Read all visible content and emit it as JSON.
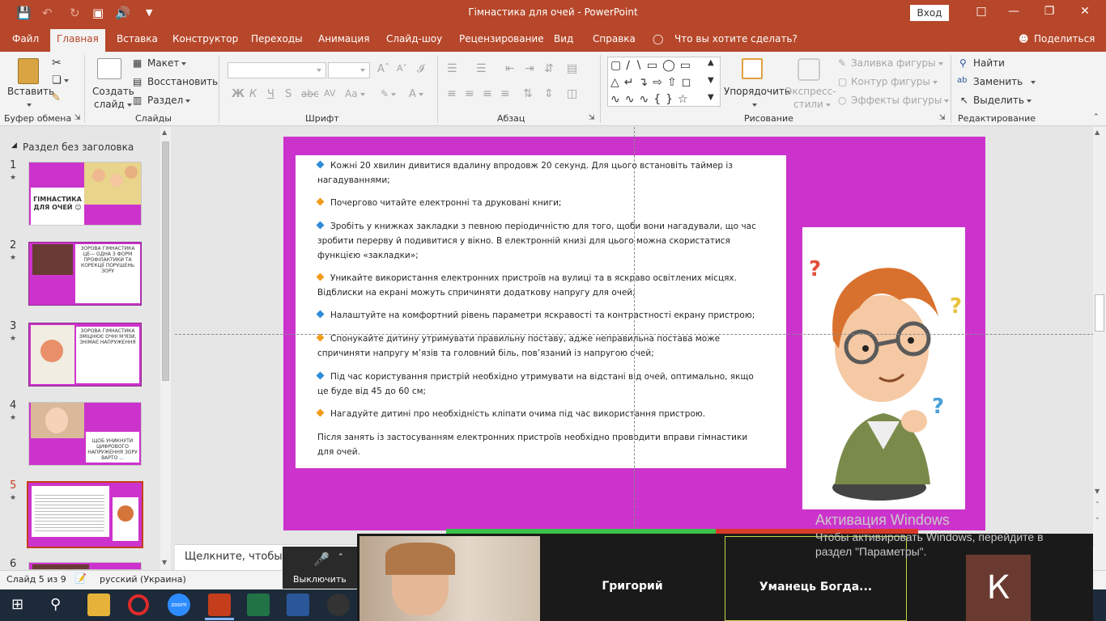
{
  "app": {
    "title": "Гімнастика для очей  -  PowerPoint",
    "signin": "Вход"
  },
  "tabs": [
    "Файл",
    "Главная",
    "Вставка",
    "Конструктор",
    "Переходы",
    "Анимация",
    "Слайд-шоу",
    "Рецензирование",
    "Вид",
    "Справка",
    "Что вы хотите сделать?"
  ],
  "share": "Поделиться",
  "ribbon": {
    "paste": "Вставить",
    "clipboard_group": "Буфер обмена",
    "new_slide_1": "Создать",
    "new_slide_2": "слайд",
    "layout": "Макет",
    "reset": "Восстановить",
    "section": "Раздел",
    "slides_group": "Слайды",
    "font_group": "Шрифт",
    "paragraph_group": "Абзац",
    "arrange": "Упорядочить",
    "quick_styles_1": "Экспресс-",
    "quick_styles_2": "стили",
    "shape_fill": "Заливка фигуры",
    "shape_outline": "Контур фигуры",
    "shape_effects": "Эффекты фигуры",
    "drawing_group": "Рисование",
    "find": "Найти",
    "replace": "Заменить",
    "select": "Выделить",
    "editing_group": "Редактирование"
  },
  "leftpane": {
    "section": "Раздел без заголовка",
    "thumbs": [
      {
        "num": "1",
        "text": "ГІМНАСТИКА ДЛЯ ОЧЕЙ ☺"
      },
      {
        "num": "2",
        "text": "ЗОРОВА ГІМНАСТИКА ЦЕ— ОДНА З ФОРМ ПРОФІЛАКТИКИ ТА КОРЕКЦІЇ ПОРУШЕНЬ ЗОРУ"
      },
      {
        "num": "3",
        "text": "ЗОРОВА ГІМНАСТИКА ЗМІЦНЮЄ ОЧНІ М'ЯЗИ, ЗНІМАЄ НАПРУЖЕННЯ"
      },
      {
        "num": "4",
        "text": "ЩОБ УНИКНУТИ ЦИФРОВОГО НАПРУЖЕННЯ ЗОРУ ВАРТО ..."
      },
      {
        "num": "5",
        "text": ""
      },
      {
        "num": "6",
        "text": ""
      }
    ]
  },
  "slide": {
    "bullets": [
      "Кожні 20 хвилин дивитися вдалину впродовж 20 секунд. Для цього встановіть таймер із нагадуваннями;",
      "Почергово читайте електронні та друковані книги;",
      "Зробіть у книжках закладки з певною періодичністю для того, щоби вони нагадували, що час зробити перерву й подивитися у вікно. В електронній книзі для цього можна скористатися функцією «закладки»;",
      "Уникайте використання електронних пристроїв на вулиці та в яскраво освітлених місцях. Відблиски на екрані можуть спричиняти додаткову напругу для очей;",
      "Налаштуйте на комфортний рівень параметри яскравості та контрастності екрану пристрою;",
      "Спонукайте дитину утримувати правильну поставу, адже неправильна постава може спричиняти напругу м’язів та головний біль, пов’язаний із напругою очей;",
      "Під час користування пристрій необхідно утримувати на відстані від очей, оптимально, якщо це буде від 45 до 60 см;",
      "Нагадуйте дитині про необхідність кліпати очима під час використання пристрою."
    ],
    "closing": "Після занять із застосуванням електронних пристроїв необхідно проводити вправи гімнастики для очей."
  },
  "notes": "Щелкните, чтобы",
  "status": {
    "slide_of": "Слайд 5 из 9",
    "language": "русский (Украина)"
  },
  "zoom": {
    "mute": "Выключить",
    "p1": "Григорий",
    "p2": "Уманець  Богда...",
    "p3_initial": "К"
  },
  "watermark": {
    "line1": "Активация Windows",
    "line2": "Чтобы активировать Windows, перейдите в",
    "line3": "раздел \"Параметры\"."
  },
  "colors": {
    "accent": "#b7472a",
    "slide_bg": "#cc33cc"
  }
}
